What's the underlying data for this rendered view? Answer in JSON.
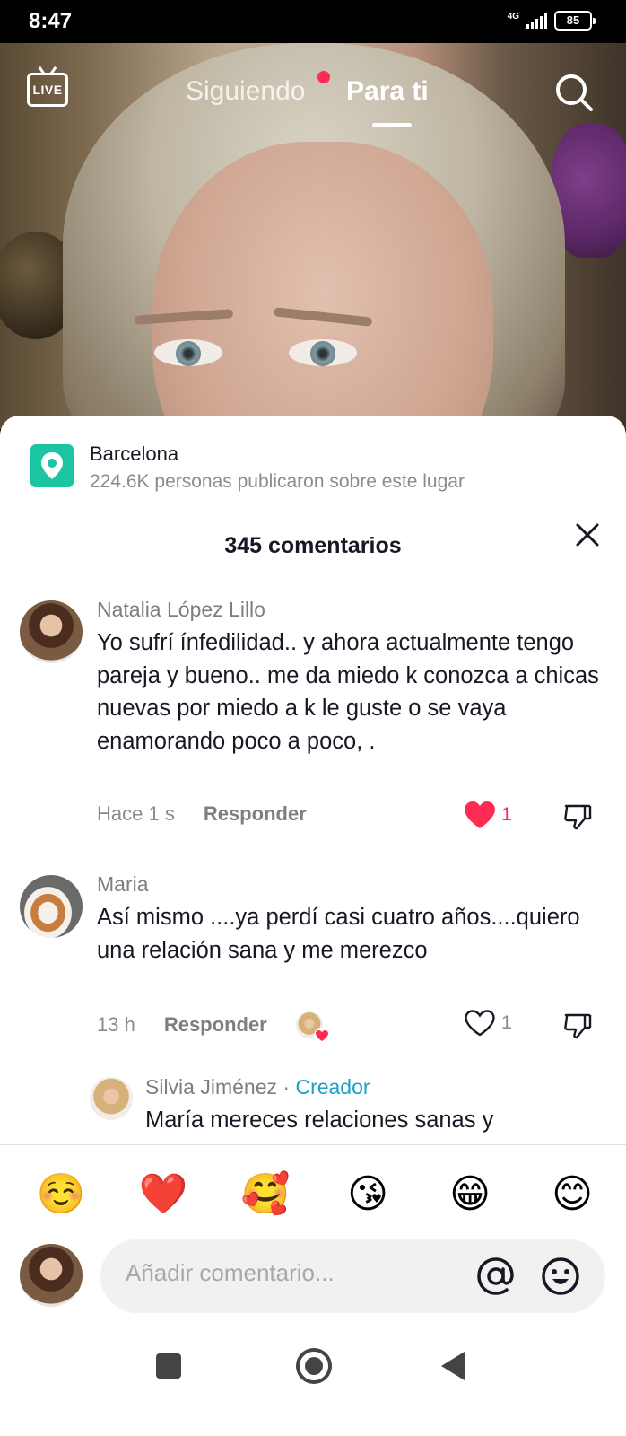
{
  "status_bar": {
    "time": "8:47",
    "network": "4G",
    "battery": "85"
  },
  "top_nav": {
    "live_label": "LIVE",
    "tabs": [
      {
        "label": "Siguiendo",
        "active": false
      },
      {
        "label": "Para ti",
        "active": true
      }
    ]
  },
  "location": {
    "name": "Barcelona",
    "subtitle": "224.6K personas publicaron sobre este lugar"
  },
  "comments_sheet": {
    "title": "345 comentarios"
  },
  "comments": [
    {
      "user": "Natalia López Lillo",
      "text": "Yo sufrí ínfedilidad.. y ahora actualmente tengo pareja y bueno.. me da miedo k conozca a chicas nuevas por miedo a k le guste o se vaya enamorando poco a poco, .",
      "time": "Hace 1 s",
      "reply_label": "Responder",
      "likes": "1",
      "liked": true
    },
    {
      "user": "Maria",
      "text": "Así mismo ....ya perdí casi cuatro años....quiero una relación sana y me merezco",
      "time": "13 h",
      "reply_label": "Responder",
      "likes": "1",
      "liked": false
    },
    {
      "user": "Silvia Jiménez",
      "separator": " · ",
      "tag": "Creador",
      "text": "María mereces relaciones sanas y"
    }
  ],
  "emoji_bar": [
    "☺️",
    "❤️",
    "🥰",
    "😘",
    "😁",
    "😊"
  ],
  "input": {
    "placeholder": "Añadir comentario..."
  },
  "colors": {
    "accent_red": "#fe2c55",
    "creator_blue": "#1e9fc6",
    "location_green": "#1cc5a1"
  }
}
